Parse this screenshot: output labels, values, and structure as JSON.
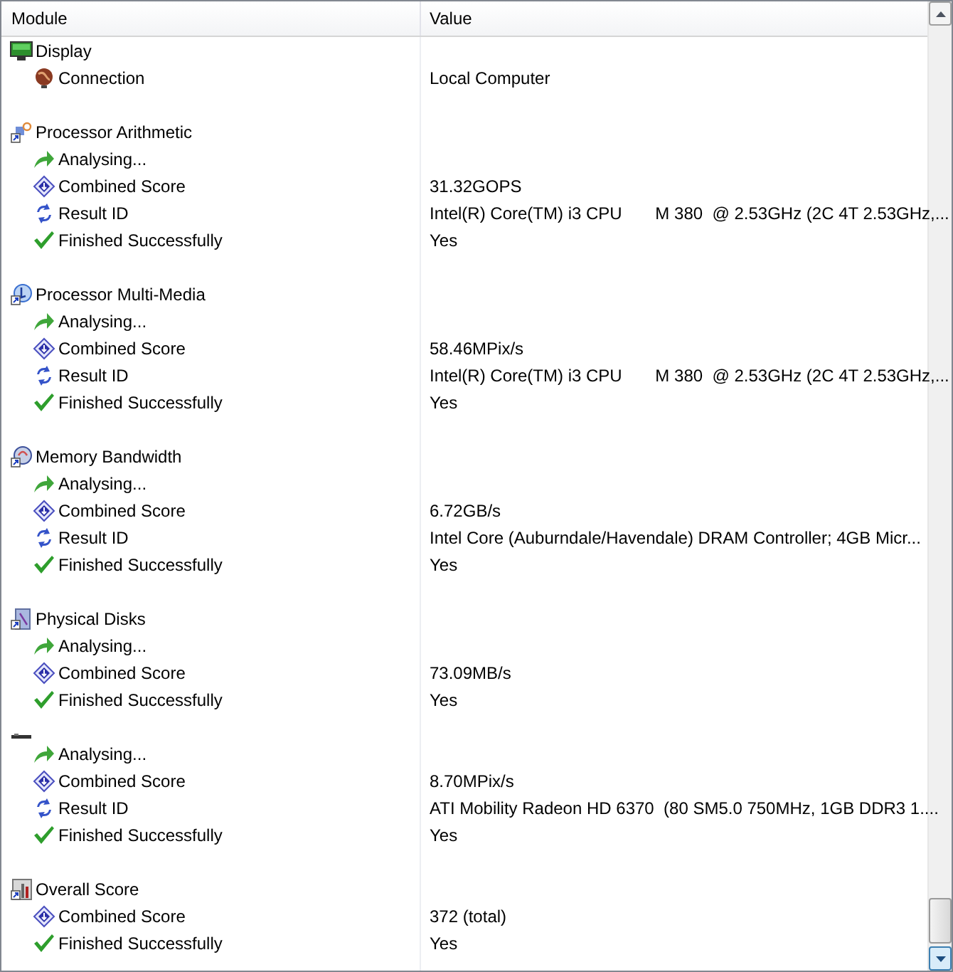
{
  "columns": [
    "Module",
    "Value"
  ],
  "rows": [
    {
      "kind": "display",
      "module": "Display"
    },
    {
      "kind": "connection",
      "module": "Connection",
      "value": "Local Computer"
    },
    {
      "kind": "blank"
    },
    {
      "kind": "cpu",
      "module": "Processor Arithmetic"
    },
    {
      "kind": "analysing",
      "module": "Analysing..."
    },
    {
      "kind": "score",
      "module": "Combined Score",
      "value": "31.32GOPS"
    },
    {
      "kind": "result",
      "module": "Result ID",
      "value": "Intel(R) Core(TM) i3 CPU       M 380  @ 2.53GHz (2C 4T 2.53GHz,..."
    },
    {
      "kind": "finished",
      "module": "Finished Successfully",
      "value": "Yes"
    },
    {
      "kind": "blank"
    },
    {
      "kind": "multimedia",
      "module": "Processor Multi-Media"
    },
    {
      "kind": "analysing",
      "module": "Analysing..."
    },
    {
      "kind": "score",
      "module": "Combined Score",
      "value": "58.46MPix/s"
    },
    {
      "kind": "result",
      "module": "Result ID",
      "value": "Intel(R) Core(TM) i3 CPU       M 380  @ 2.53GHz (2C 4T 2.53GHz,..."
    },
    {
      "kind": "finished",
      "module": "Finished Successfully",
      "value": "Yes"
    },
    {
      "kind": "blank"
    },
    {
      "kind": "memory",
      "module": "Memory Bandwidth"
    },
    {
      "kind": "analysing",
      "module": "Analysing..."
    },
    {
      "kind": "score",
      "module": "Combined Score",
      "value": "6.72GB/s"
    },
    {
      "kind": "result",
      "module": "Result ID",
      "value": "Intel Core (Auburndale/Havendale) DRAM Controller; 4GB Micr..."
    },
    {
      "kind": "finished",
      "module": "Finished Successfully",
      "value": "Yes"
    },
    {
      "kind": "blank"
    },
    {
      "kind": "disk",
      "module": "Physical Disks"
    },
    {
      "kind": "analysing",
      "module": "Analysing..."
    },
    {
      "kind": "score",
      "module": "Combined Score",
      "value": "73.09MB/s"
    },
    {
      "kind": "finished",
      "module": "Finished Successfully",
      "value": "Yes"
    },
    {
      "kind": "gpu"
    },
    {
      "kind": "analysing",
      "module": "Analysing..."
    },
    {
      "kind": "score",
      "module": "Combined Score",
      "value": "8.70MPix/s"
    },
    {
      "kind": "result",
      "module": "Result ID",
      "value": "ATI Mobility Radeon HD 6370  (80 SM5.0 750MHz, 1GB DDR3 1...."
    },
    {
      "kind": "finished",
      "module": "Finished Successfully",
      "value": "Yes"
    },
    {
      "kind": "blank"
    },
    {
      "kind": "overall",
      "module": "Overall Score"
    },
    {
      "kind": "score",
      "module": "Combined Score",
      "value": "372 (total)"
    },
    {
      "kind": "finished",
      "module": "Finished Successfully",
      "value": "Yes"
    }
  ]
}
